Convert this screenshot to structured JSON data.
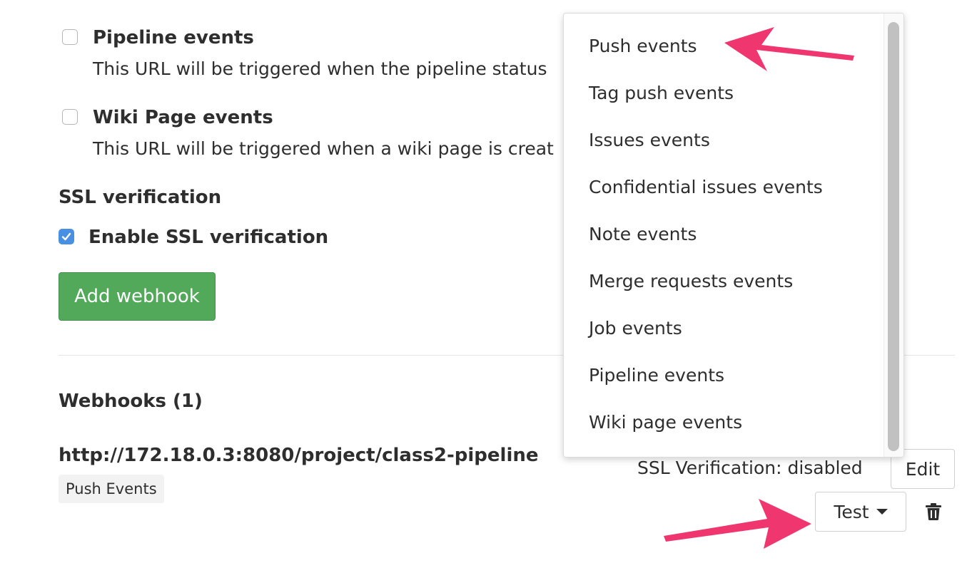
{
  "events": [
    {
      "title": "Pipeline events",
      "description": "This URL will be triggered when the pipeline status"
    },
    {
      "title": "Wiki Page events",
      "description": "This URL will be triggered when a wiki page is creat"
    }
  ],
  "ssl": {
    "section_title": "SSL verification",
    "checkbox_label": "Enable SSL verification",
    "checked": true
  },
  "form": {
    "add_button": "Add webhook"
  },
  "webhooks": {
    "title": "Webhooks (1)",
    "items": [
      {
        "url": "http://172.18.0.3:8080/project/class2-pipeline",
        "badge": "Push Events",
        "ssl_status": "SSL Verification: disabled",
        "edit_label": "Edit",
        "test_label": "Test"
      }
    ]
  },
  "test_menu": {
    "items": [
      "Push events",
      "Tag push events",
      "Issues events",
      "Confidential issues events",
      "Note events",
      "Merge requests events",
      "Job events",
      "Pipeline events",
      "Wiki page events"
    ]
  },
  "colors": {
    "add_button": "#52a95a",
    "checkbox_checked": "#4a90e2",
    "annotation_arrow": "#f0366f"
  },
  "icons": [
    "checkbox-icon",
    "checkmark-icon",
    "caret-down-icon",
    "trash-icon",
    "arrow-annotation"
  ]
}
